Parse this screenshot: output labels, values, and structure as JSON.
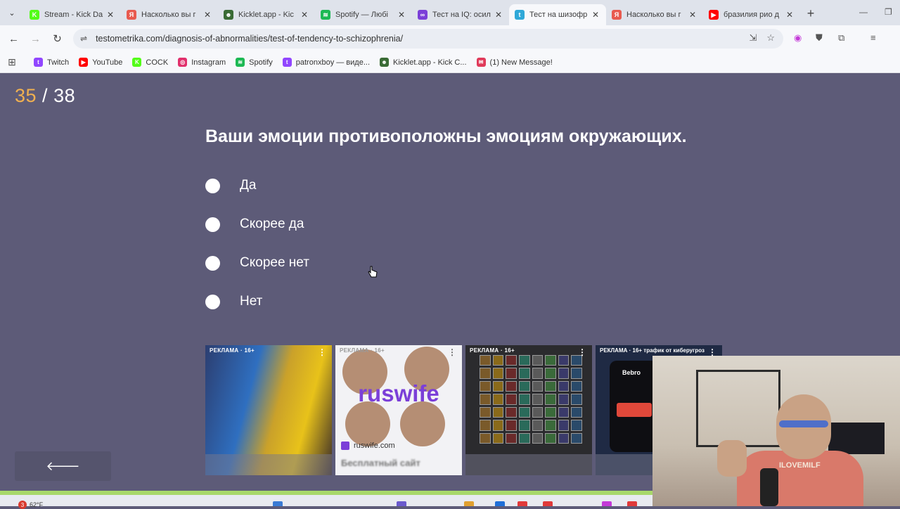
{
  "browser": {
    "tabs": [
      {
        "title": "Stream - Kick Da",
        "favicon": "kick",
        "color": "#53fc18",
        "glyph": "K",
        "active": false
      },
      {
        "title": "Насколько вы г",
        "favicon": "yandex",
        "color": "#e85a4f",
        "glyph": "Я",
        "active": false
      },
      {
        "title": "Kicklet.app - Kic",
        "favicon": "kicklet",
        "color": "#3a6b35",
        "glyph": "☻",
        "active": false
      },
      {
        "title": "Spotify — Любі",
        "favicon": "spotify",
        "color": "#1db954",
        "glyph": "≋",
        "active": false
      },
      {
        "title": "Тест на IQ: осил",
        "favicon": "iq",
        "color": "#7b3fd8",
        "glyph": "∞",
        "active": false
      },
      {
        "title": "Тест на шизофр",
        "favicon": "testometrika",
        "color": "#2fa8d8",
        "glyph": "t",
        "active": true
      },
      {
        "title": "Насколько вы г",
        "favicon": "yandex",
        "color": "#e85a4f",
        "glyph": "Я",
        "active": false
      },
      {
        "title": "бразилия рио д",
        "favicon": "youtube",
        "color": "#ff0000",
        "glyph": "▶",
        "active": false
      }
    ],
    "close_glyph": "✕",
    "new_tab_glyph": "+",
    "tab_search_glyph": "⌄",
    "window_minimize": "—",
    "window_maximize": "❐",
    "back_glyph": "←",
    "forward_glyph": "→",
    "reload_glyph": "↻",
    "site_info_glyph": "⇌",
    "url": "testometrika.com/diagnosis-of-abnormalities/test-of-tendency-to-schizophrenia/",
    "omnibox_icons": {
      "install": "⇲",
      "bookmark_star": "☆"
    },
    "extension_glyphs": {
      "ext1": "◉",
      "ext2": "⛊",
      "extensions": "⧉",
      "media": "≡"
    }
  },
  "bookmarks": {
    "apps_glyph": "⊞",
    "items": [
      {
        "label": "Twitch",
        "color": "#9146ff",
        "glyph": "t"
      },
      {
        "label": "YouTube",
        "color": "#ff0000",
        "glyph": "▶"
      },
      {
        "label": "COCK",
        "color": "#53fc18",
        "glyph": "K"
      },
      {
        "label": "Instagram",
        "color": "#e1306c",
        "glyph": "◎"
      },
      {
        "label": "Spotify",
        "color": "#1db954",
        "glyph": "≋"
      },
      {
        "label": "patronxboy — виде...",
        "color": "#9146ff",
        "glyph": "t"
      },
      {
        "label": "Kicklet.app - Kick C...",
        "color": "#3a6b35",
        "glyph": "☻"
      },
      {
        "label": "(1) New Message!",
        "color": "#e03a5a",
        "glyph": "✉"
      }
    ]
  },
  "quiz": {
    "counter_current": "35",
    "counter_separator": " / ",
    "counter_total": "38",
    "question": "Ваши эмоции противоположны эмоциям окружающих.",
    "options": [
      "Да",
      "Скорее да",
      "Скорее нет",
      "Нет"
    ],
    "back_glyph": "🡐",
    "colors": {
      "background": "#5d5b78",
      "counter_current": "#f0b050",
      "text": "#ffffff"
    }
  },
  "ads": {
    "label": "РЕКЛАМА · 16+",
    "more_glyph": "⋮",
    "ruswife_text": "ruswife",
    "ruswife_domain": "ruswife.com",
    "ruswife_sub": "Бесплатный сайт",
    "ad4_label": "РЕКЛАМА · 16+ трафик от киберугроз",
    "ad4_brand": "Bebro"
  },
  "webcam": {
    "shirt_text": "ILOVEMILF"
  },
  "taskbar": {
    "weather_badge": "3",
    "weather_temp": "62°F"
  }
}
